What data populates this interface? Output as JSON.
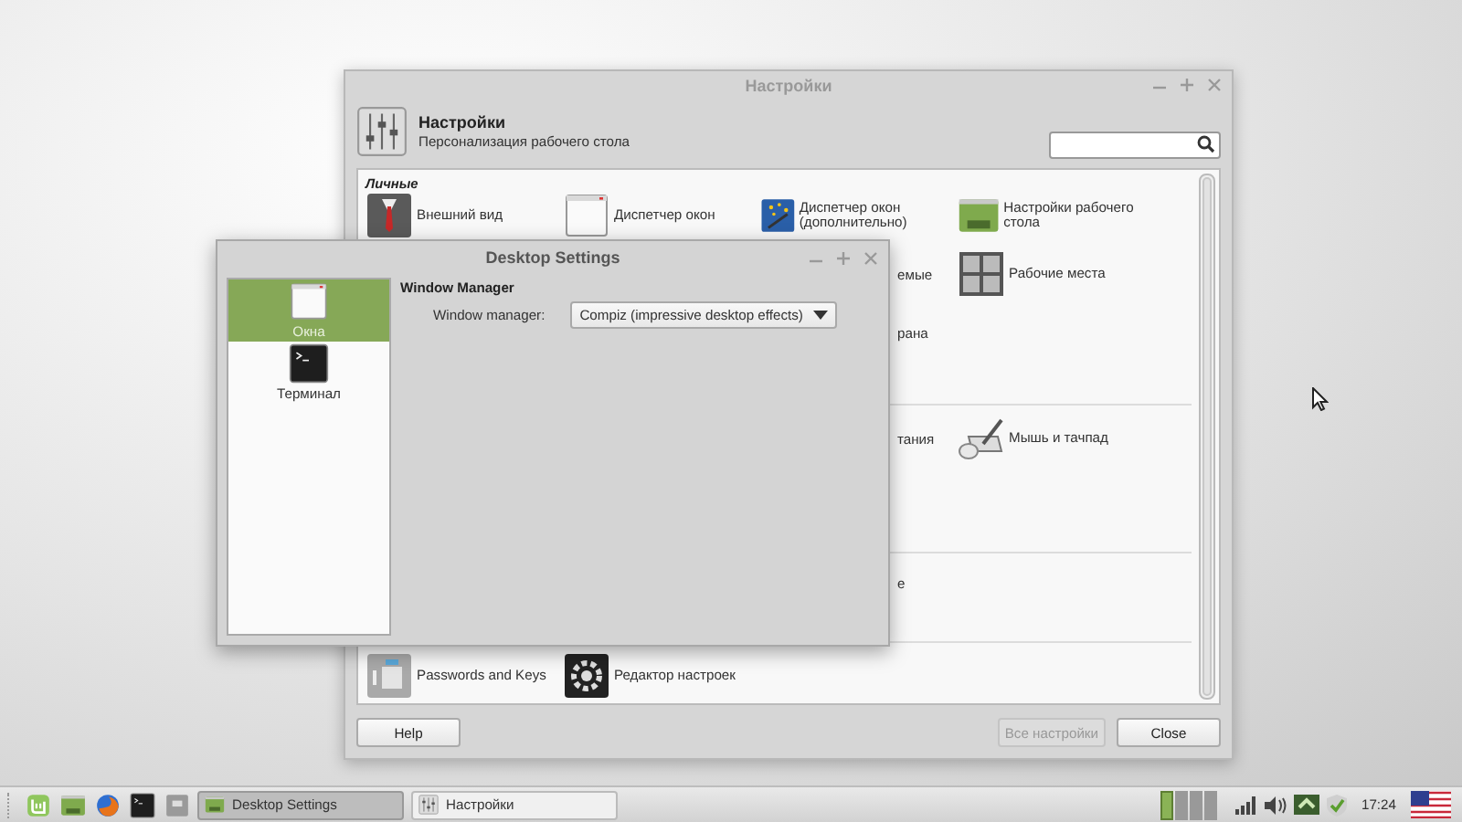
{
  "main_window": {
    "title": "Настройки",
    "header_title": "Настройки",
    "header_subtitle": "Персонализация рабочего стола",
    "sections": [
      {
        "heading": "Личные",
        "items": [
          {
            "kind": "suit",
            "label": "Внешний вид"
          },
          {
            "kind": "window",
            "label": "Диспетчер окон"
          },
          {
            "kind": "compiz",
            "label": "Диспетчер окон (дополнительно)"
          },
          {
            "kind": "desktop",
            "label": "Настройки рабочего стола"
          },
          {
            "kind": "partial",
            "label": "емые"
          },
          {
            "kind": "workspaces",
            "label": "Рабочие места"
          },
          {
            "kind": "partial",
            "label": "рана"
          }
        ]
      },
      {
        "items": [
          {
            "kind": "partial",
            "label": "тания"
          },
          {
            "kind": "mouse",
            "label": "Мышь и тачпад"
          }
        ]
      },
      {
        "items": [
          {
            "kind": "partial",
            "label": "е"
          }
        ]
      },
      {
        "items": [
          {
            "kind": "keys",
            "label": "Passwords and Keys"
          },
          {
            "kind": "editor",
            "label": "Редактор настроек"
          }
        ]
      }
    ],
    "buttons": [
      {
        "label": "Help",
        "disabled": false
      },
      {
        "label": "Все настройки",
        "disabled": true
      },
      {
        "label": "Close",
        "disabled": false
      }
    ]
  },
  "desktop_settings": {
    "title": "Desktop Settings",
    "sidebar": [
      {
        "kind": "window",
        "label": "Окна",
        "selected": true
      },
      {
        "kind": "terminal",
        "label": "Терминал",
        "selected": false
      }
    ],
    "section_title": "Window Manager",
    "field_label": "Window manager:",
    "dropdown_value": "Compiz (impressive desktop effects)"
  },
  "taskbar": {
    "launchers": [
      {
        "kind": "mint"
      },
      {
        "kind": "desktop"
      },
      {
        "kind": "firefox"
      },
      {
        "kind": "terminal"
      },
      {
        "kind": "grey"
      }
    ],
    "windows": [
      {
        "kind": "desktop",
        "label": "Desktop Settings",
        "selected": true
      },
      {
        "kind": "settings",
        "label": "Настройки",
        "selected": false
      }
    ],
    "workspaces": [
      {
        "selected": true
      },
      {
        "selected": false
      },
      {
        "selected": false
      },
      {
        "selected": false
      }
    ],
    "clock": "17:24"
  }
}
